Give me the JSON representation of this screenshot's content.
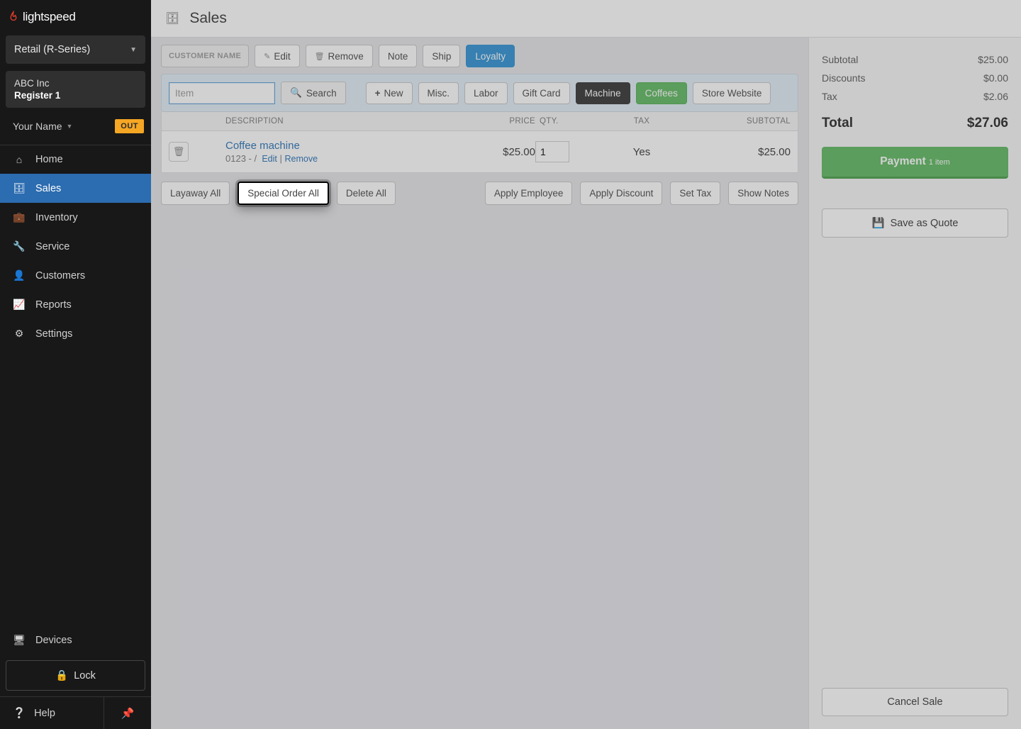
{
  "brand": {
    "name": "lightspeed"
  },
  "retailSelector": "Retail (R-Series)",
  "company": {
    "name": "ABC Inc",
    "register": "Register 1"
  },
  "user": {
    "name": "Your Name",
    "status": "OUT"
  },
  "nav": {
    "home": "Home",
    "sales": "Sales",
    "inventory": "Inventory",
    "service": "Service",
    "customers": "Customers",
    "reports": "Reports",
    "settings": "Settings",
    "devices": "Devices",
    "lock": "Lock",
    "help": "Help"
  },
  "page": {
    "title": "Sales"
  },
  "toolbar": {
    "customer": "CUSTOMER NAME",
    "edit": "Edit",
    "remove": "Remove",
    "note": "Note",
    "ship": "Ship",
    "loyalty": "Loyalty"
  },
  "search": {
    "placeholder": "Item",
    "searchBtn": "Search",
    "new": "New",
    "misc": "Misc.",
    "labor": "Labor",
    "giftcard": "Gift Card",
    "machine": "Machine",
    "coffees": "Coffees",
    "store": "Store Website"
  },
  "columns": {
    "desc": "DESCRIPTION",
    "price": "PRICE",
    "qty": "QTY.",
    "tax": "TAX",
    "subtotal": "SUBTOTAL"
  },
  "line": {
    "name": "Coffee machine",
    "sku": "0123 - /",
    "edit": "Edit",
    "remove": "Remove",
    "price": "$25.00",
    "qty": "1",
    "tax": "Yes",
    "subtotal": "$25.00"
  },
  "actions": {
    "layaway": "Layaway All",
    "specialOrder": "Special Order All",
    "deleteAll": "Delete All",
    "applyEmp": "Apply Employee",
    "applyDisc": "Apply Discount",
    "setTax": "Set Tax",
    "showNotes": "Show Notes"
  },
  "summary": {
    "subtotalLabel": "Subtotal",
    "subtotalVal": "$25.00",
    "discountLabel": "Discounts",
    "discountVal": "$0.00",
    "taxLabel": "Tax",
    "taxVal": "$2.06",
    "totalLabel": "Total",
    "totalVal": "$27.06",
    "paymentLabel": "Payment",
    "paymentSub": "1 item",
    "quote": "Save as Quote",
    "cancel": "Cancel Sale"
  }
}
